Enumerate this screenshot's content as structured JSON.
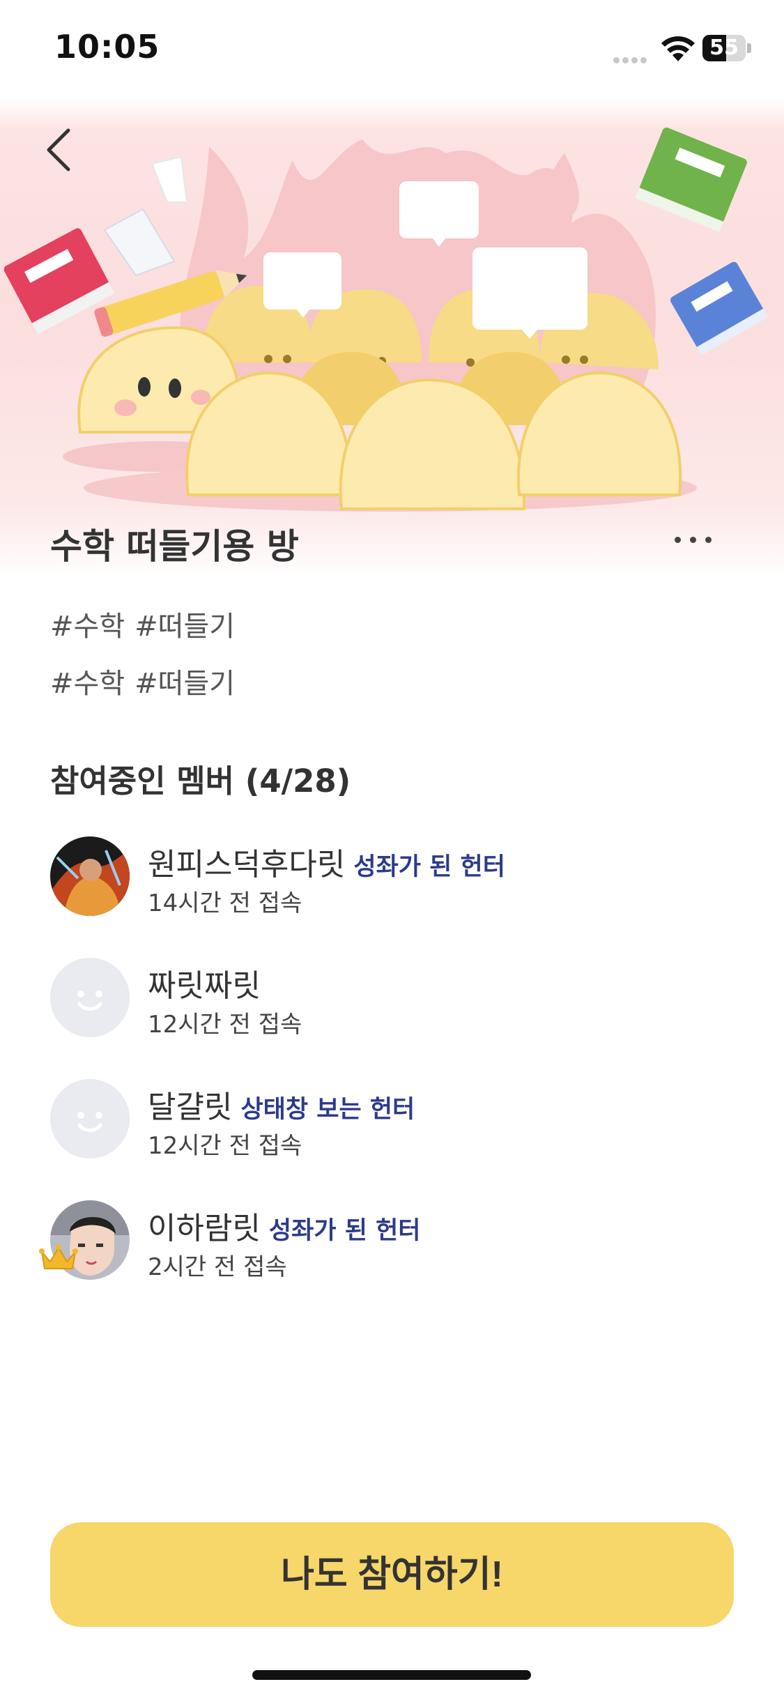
{
  "status_bar": {
    "time": "10:05",
    "battery": "55",
    "battery_level": 0.55
  },
  "room": {
    "title": "수학 떠들기용 방",
    "tags_line1": [
      "#수학",
      "#떠들기"
    ],
    "tags_line2": [
      "#수학",
      "#떠들기"
    ]
  },
  "members": {
    "heading": "참여중인 멤버",
    "count": "(4/28)",
    "list": [
      {
        "name": "원피스덕후다릿",
        "title": "성좌가 된 헌터",
        "last_seen": "14시간 전 접속",
        "avatar": "photo-avatar"
      },
      {
        "name": "짜릿짜릿",
        "title": "",
        "last_seen": "12시간 전 접속",
        "avatar": "default-face-icon"
      },
      {
        "name": "달걀릿",
        "title": "상태창 보는 헌터",
        "last_seen": "12시간 전 접속",
        "avatar": "default-face-icon"
      },
      {
        "name": "이하람릿",
        "title": "성좌가 된 헌터",
        "last_seen": "2시간 전 접속",
        "avatar": "photo-avatar",
        "owner_badge": "crown-icon"
      }
    ]
  },
  "join_button": {
    "label": "나도 참여하기!"
  },
  "colors": {
    "accent": "#f7d66a",
    "hero_bg": "#fbdede",
    "title_link": "#2c3a8c"
  }
}
